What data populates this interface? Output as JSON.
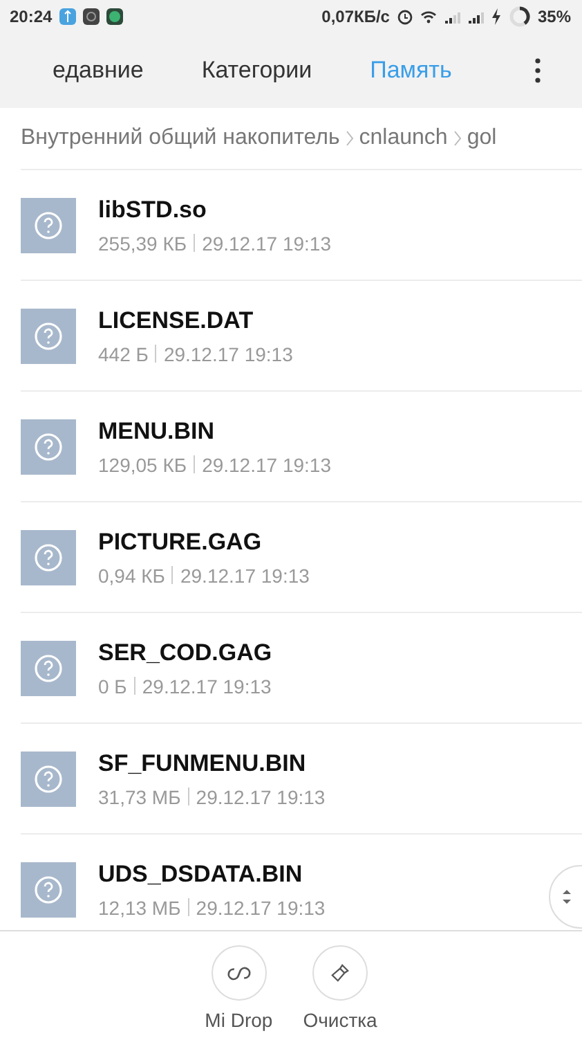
{
  "status_bar": {
    "time": "20:24",
    "speed": "0,07КБ/с",
    "battery": "35%"
  },
  "tabs": [
    {
      "label": "едавние",
      "selected": false
    },
    {
      "label": "Категории",
      "selected": false
    },
    {
      "label": "Память",
      "selected": true
    }
  ],
  "breadcrumb": [
    "Внутренний общий накопитель",
    "cnlaunch",
    "gol"
  ],
  "files": [
    {
      "name": "libSTD.so",
      "size": "255,39 КБ",
      "date": "29.12.17 19:13"
    },
    {
      "name": "LICENSE.DAT",
      "size": "442 Б",
      "date": "29.12.17 19:13"
    },
    {
      "name": "MENU.BIN",
      "size": "129,05 КБ",
      "date": "29.12.17 19:13"
    },
    {
      "name": "PICTURE.GAG",
      "size": "0,94 КБ",
      "date": "29.12.17 19:13"
    },
    {
      "name": "SER_COD.GAG",
      "size": "0 Б",
      "date": "29.12.17 19:13"
    },
    {
      "name": "SF_FUNMENU.BIN",
      "size": "31,73 МБ",
      "date": "29.12.17 19:13"
    },
    {
      "name": "UDS_DSDATA.BIN",
      "size": "12,13 МБ",
      "date": "29.12.17 19:13"
    }
  ],
  "actions": [
    {
      "label": "Mi Drop",
      "kind": "drop"
    },
    {
      "label": "Очистка",
      "kind": "clean"
    }
  ]
}
